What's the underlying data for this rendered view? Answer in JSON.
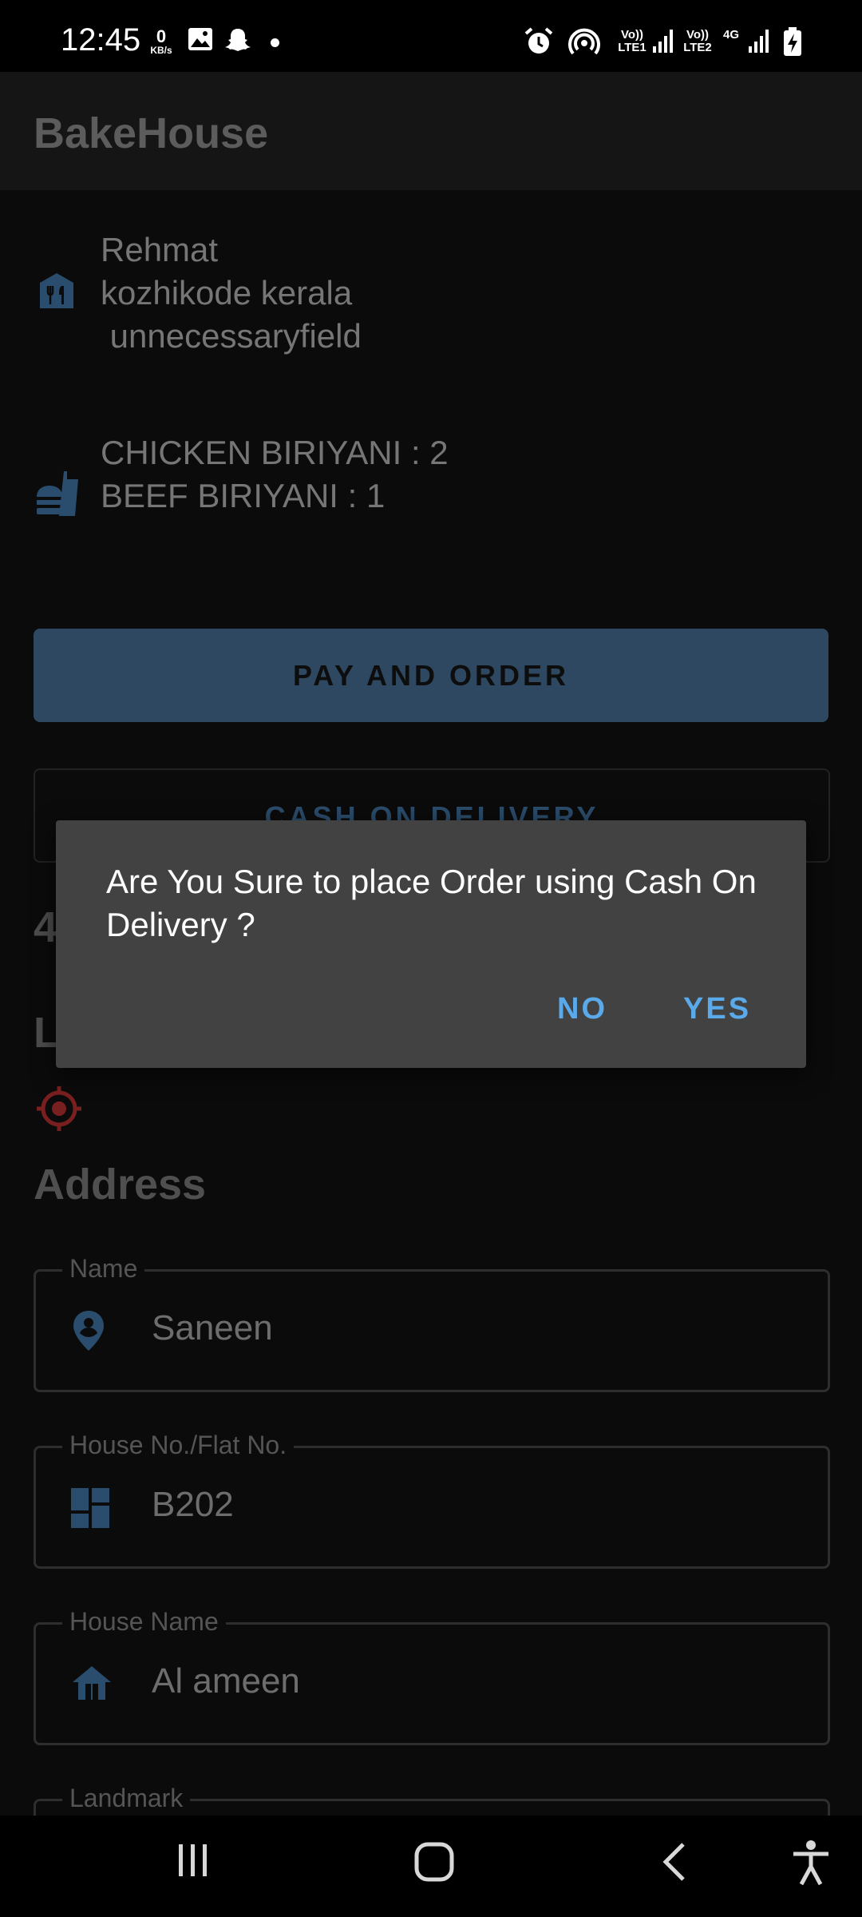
{
  "status_bar": {
    "time": "12:45",
    "net_speed_value": "0",
    "net_speed_unit": "KB/s",
    "sim1_label": "Vo)) LTE1",
    "sim2_label": "Vo)) LTE2",
    "network_type": "4G"
  },
  "app": {
    "title": "BakeHouse"
  },
  "restaurant": {
    "name": "Rehmat",
    "location": "kozhikode kerala",
    "extra": " unnecessaryfield"
  },
  "order_items": [
    "CHICKEN BIRIYANI : 2",
    "BEEF BIRIYANI : 1"
  ],
  "buttons": {
    "pay_and_order": "PAY AND ORDER",
    "cash_on_delivery": "CASH ON DELIVERY"
  },
  "partially_hidden": {
    "amount_first_char": "4",
    "section_first_char": "L"
  },
  "address": {
    "title": "Address",
    "fields": [
      {
        "label": "Name",
        "value": "Saneen",
        "icon": "person-pin-icon"
      },
      {
        "label": "House No./Flat No.",
        "value": "B202",
        "icon": "dashboard-icon"
      },
      {
        "label": "House Name",
        "value": "Al ameen",
        "icon": "home-icon"
      },
      {
        "label": "Landmark",
        "value": "",
        "icon": ""
      }
    ]
  },
  "dialog": {
    "message": "Are You Sure to place Order using Cash On Delivery ?",
    "no_label": "NO",
    "yes_label": "YES"
  },
  "colors": {
    "accent_blue": "#5aa9ea",
    "button_blue": "#2d4860",
    "icon_blue": "#2a4d6e",
    "location_red": "#7a1f1f",
    "dialog_bg": "#424242"
  }
}
